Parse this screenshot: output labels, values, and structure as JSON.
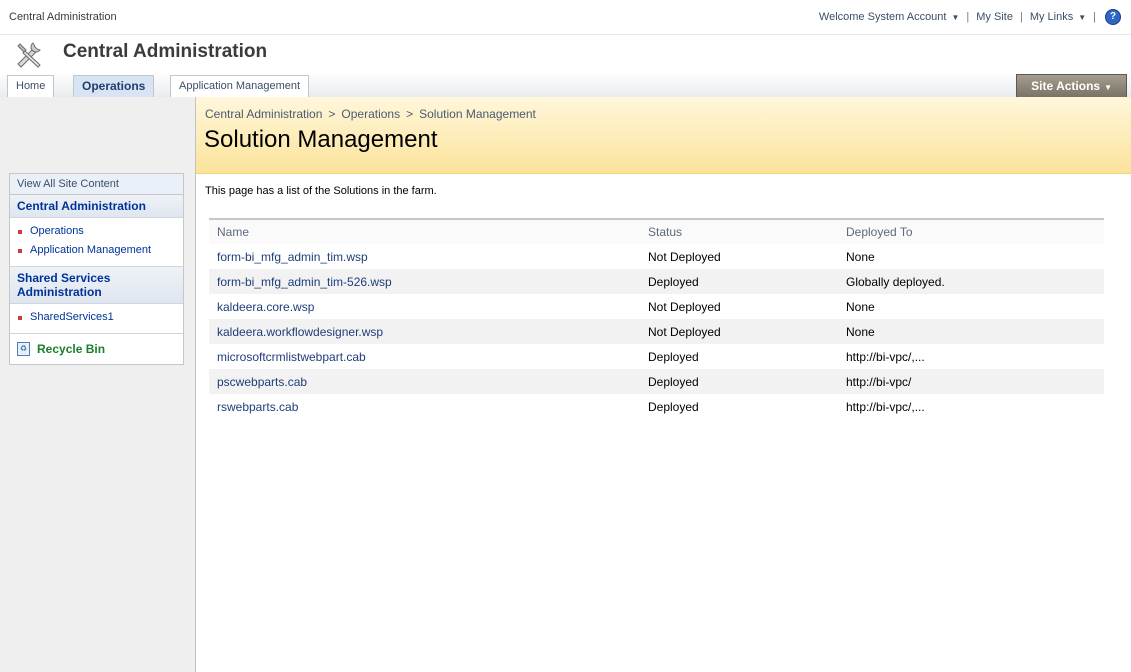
{
  "topbar": {
    "site_title": "Central Administration",
    "welcome": "Welcome System Account",
    "my_site": "My Site",
    "my_links": "My Links",
    "help_icon": "help-icon"
  },
  "header": {
    "title": "Central Administration",
    "logo_icon": "tools-icon"
  },
  "nav": {
    "tabs": [
      {
        "label": "Home",
        "selected": false
      },
      {
        "label": "Operations",
        "selected": true
      },
      {
        "label": "Application Management",
        "selected": false
      }
    ],
    "site_actions": "Site Actions"
  },
  "sidebar": {
    "view_all": "View All Site Content",
    "sections": [
      {
        "heading": "Central Administration",
        "items": [
          "Operations",
          "Application Management"
        ]
      },
      {
        "heading": "Shared Services Administration",
        "items": [
          "SharedServices1"
        ]
      }
    ],
    "recycle_bin": "Recycle Bin"
  },
  "main": {
    "breadcrumb": [
      "Central Administration",
      "Operations",
      "Solution Management"
    ],
    "breadcrumb_sep": ">",
    "page_title": "Solution Management",
    "description": "This page has a list of the Solutions in the farm.",
    "table": {
      "headers": [
        "Name",
        "Status",
        "Deployed To"
      ],
      "rows": [
        {
          "name": "form-bi_mfg_admin_tim.wsp",
          "status": "Not Deployed",
          "deployed_to": "None"
        },
        {
          "name": "form-bi_mfg_admin_tim-526.wsp",
          "status": "Deployed",
          "deployed_to": "Globally deployed."
        },
        {
          "name": "kaldeera.core.wsp",
          "status": "Not Deployed",
          "deployed_to": "None"
        },
        {
          "name": "kaldeera.workflowdesigner.wsp",
          "status": "Not Deployed",
          "deployed_to": "None"
        },
        {
          "name": "microsoftcrmlistwebpart.cab",
          "status": "Deployed",
          "deployed_to": "http://bi-vpc/,..."
        },
        {
          "name": "pscwebparts.cab",
          "status": "Deployed",
          "deployed_to": "http://bi-vpc/"
        },
        {
          "name": "rswebparts.cab",
          "status": "Deployed",
          "deployed_to": "http://bi-vpc/,..."
        }
      ]
    }
  },
  "colors": {
    "link": "#1f3d7a",
    "banner_top": "#fff7dc",
    "banner_bottom": "#fce39a",
    "site_actions_bg": "#7a7264",
    "recycle_green": "#1a7f2d"
  }
}
